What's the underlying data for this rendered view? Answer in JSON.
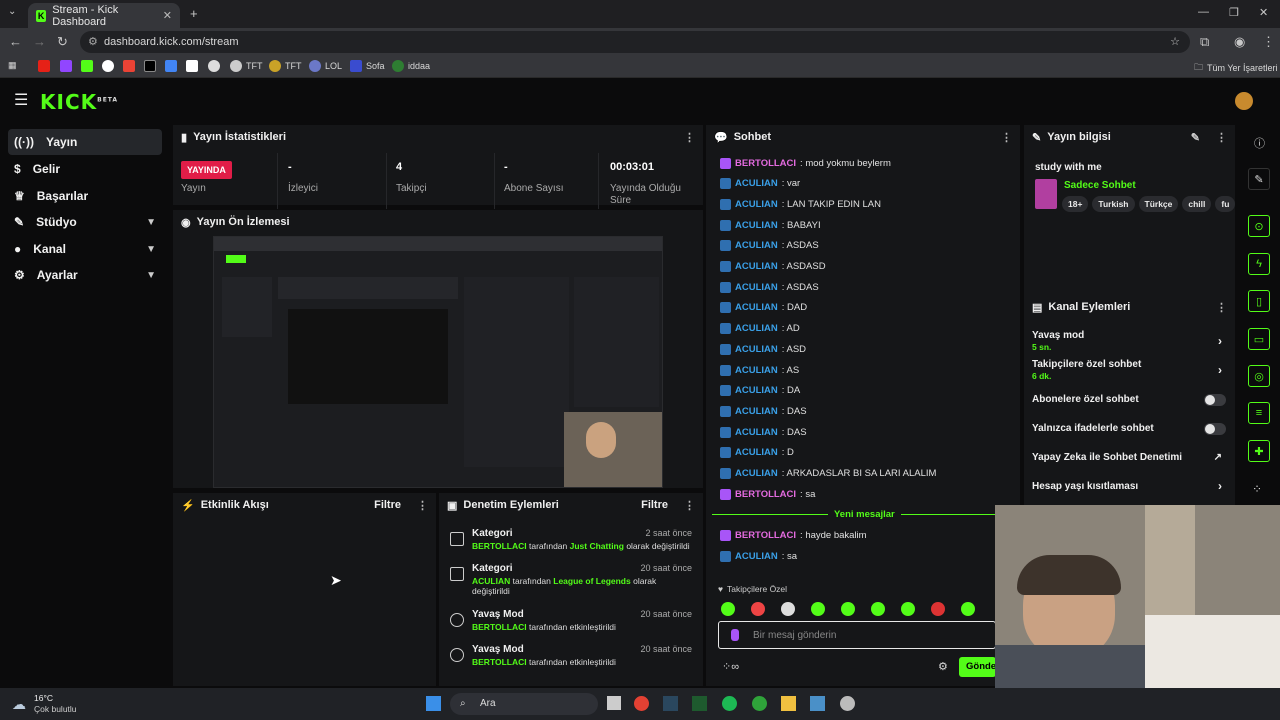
{
  "browser": {
    "tab_title": "Stream - Kick Dashboard",
    "url": "dashboard.kick.com/stream",
    "bookmarks": [
      "TFT",
      "TFT",
      "LOL",
      "Sofa",
      "iddaa"
    ],
    "bookmarks_folder": "Tüm Yer İşaretleri"
  },
  "header": {
    "logo": "KICK",
    "logo_sup": "BETA"
  },
  "sidebar": {
    "items": [
      {
        "label": "Yayın",
        "icon": "broadcast-icon"
      },
      {
        "label": "Gelir",
        "icon": "money-icon"
      },
      {
        "label": "Başarılar",
        "icon": "trophy-icon"
      },
      {
        "label": "Stüdyo",
        "icon": "studio-icon"
      },
      {
        "label": "Kanal",
        "icon": "user-icon"
      },
      {
        "label": "Ayarlar",
        "icon": "gear-icon"
      }
    ]
  },
  "stats": {
    "title": "Yayın İstatistikleri",
    "live_badge": "YAYINDA",
    "status_label": "Yayın",
    "viewers_value": "-",
    "viewers_label": "İzleyici",
    "followers_value": "4",
    "followers_label": "Takipçi",
    "subs_value": "-",
    "subs_label": "Abone Sayısı",
    "duration_value": "00:03:01",
    "duration_label": "Yayında Olduğu Süre"
  },
  "preview": {
    "title": "Yayın Ön İzlemesi"
  },
  "activity": {
    "title": "Etkinlik Akışı",
    "filter": "Filtre"
  },
  "moderation": {
    "title": "Denetim Eylemleri",
    "filter": "Filtre",
    "items": [
      {
        "title": "Kategori",
        "time": "2 saat önce",
        "user": "BERTOLLACI",
        "mid": " tarafından ",
        "target": "Just Chatting",
        "end": " olarak değiştirildi"
      },
      {
        "title": "Kategori",
        "time": "20 saat önce",
        "user": "ACULIAN",
        "mid": " tarafından ",
        "target": "League of Legends",
        "end": " olarak değiştirildi"
      },
      {
        "title": "Yavaş Mod",
        "time": "20 saat önce",
        "user": "BERTOLLACI",
        "mid": " tarafından etkinleştirildi",
        "target": "",
        "end": ""
      },
      {
        "title": "Yavaş Mod",
        "time": "20 saat önce",
        "user": "BERTOLLACI",
        "mid": " tarafından etkinleştirildi",
        "target": "",
        "end": ""
      }
    ]
  },
  "chat": {
    "title": "Sohbet",
    "messages": [
      {
        "user": "BERTOLLACI",
        "text": ": mod yokmu beylerm",
        "type": "ber"
      },
      {
        "user": "ACULIAN",
        "text": ": var",
        "type": "acu"
      },
      {
        "user": "ACULIAN",
        "text": ": LAN TAKIP EDIN LAN",
        "type": "acu"
      },
      {
        "user": "ACULIAN",
        "text": ": BABAYI",
        "type": "acu"
      },
      {
        "user": "ACULIAN",
        "text": ": ASDAS",
        "type": "acu"
      },
      {
        "user": "ACULIAN",
        "text": ": ASDASD",
        "type": "acu"
      },
      {
        "user": "ACULIAN",
        "text": ": ASDAS",
        "type": "acu"
      },
      {
        "user": "ACULIAN",
        "text": ": DAD",
        "type": "acu"
      },
      {
        "user": "ACULIAN",
        "text": ": AD",
        "type": "acu"
      },
      {
        "user": "ACULIAN",
        "text": ": ASD",
        "type": "acu"
      },
      {
        "user": "ACULIAN",
        "text": ": AS",
        "type": "acu"
      },
      {
        "user": "ACULIAN",
        "text": ": DA",
        "type": "acu"
      },
      {
        "user": "ACULIAN",
        "text": ": DAS",
        "type": "acu"
      },
      {
        "user": "ACULIAN",
        "text": ": DAS",
        "type": "acu"
      },
      {
        "user": "ACULIAN",
        "text": ": D",
        "type": "acu"
      },
      {
        "user": "ACULIAN",
        "text": ": ARKADASLAR BI SA LARI ALALIM",
        "type": "acu"
      },
      {
        "user": "BERTOLLACI",
        "text": ": sa",
        "type": "ber"
      }
    ],
    "new_messages": "Yeni mesajlar",
    "new": [
      {
        "user": "BERTOLLACI",
        "text": ": hayde bakalim",
        "type": "ber"
      },
      {
        "user": "ACULIAN",
        "text": ": sa",
        "type": "acu"
      }
    ],
    "emote_label": "Takipçilere Özel",
    "input_placeholder": "Bir mesaj gönderin",
    "send": "Gönder"
  },
  "stream_info": {
    "title": "Yayın bilgisi",
    "stream_title": "study with me",
    "category": "Sadece Sohbet",
    "tags": [
      "18+",
      "Turkish",
      "Türkçe",
      "chill",
      "fu"
    ]
  },
  "channel_actions": {
    "title": "Kanal Eylemleri",
    "slow_mode": "Yavaş mod",
    "slow_mode_value": "5 sn.",
    "followers_only": "Takipçilere özel sohbet",
    "followers_only_value": "6 dk.",
    "subs_only": "Abonelere özel sohbet",
    "emotes_only": "Yalnızca ifadelerle sohbet",
    "ai_moderation": "Yapay Zeka ile Sohbet Denetimi",
    "age_restriction": "Hesap yaşı kısıtlaması"
  },
  "taskbar": {
    "temp": "16°C",
    "weather": "Çok bulutlu",
    "search": "Ara"
  },
  "colors": {
    "accent": "#53fc18",
    "live": "#e11d48",
    "aculian": "#3aa0e8",
    "bertollaci": "#e46be0"
  }
}
